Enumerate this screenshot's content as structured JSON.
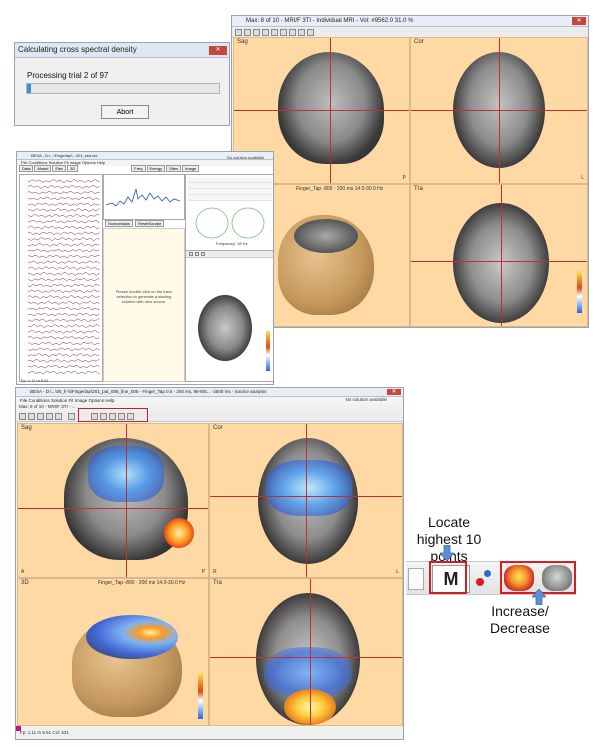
{
  "progress_dialog": {
    "title": "Calculating cross spectral density",
    "status": "Processing trial 2 of 97",
    "abort_label": "Abort",
    "progress_fraction": 0.02
  },
  "mri_window_top": {
    "title": "Max: 8 of 10 - MRI/F 3TI - Individual MRI - Vol: #9562.0 31.0 %",
    "pane_labels": {
      "sag": "Sag",
      "cor": "Cor",
      "tra": "Tra"
    },
    "caption": "Finger_Tap -800 · 200 ms 14.0-30.0 Hz",
    "corner_p": "P",
    "corner_l": "L"
  },
  "eeg_window": {
    "title": "BESA - D:\\...\\Fingertap\\...001_ssd.cnt",
    "menu": "File  Conditions  Solution  Fit  Image  Options  Help",
    "tabs": [
      "Data",
      "Model",
      "Elec",
      "3D",
      "Freq",
      "Energy",
      "Sites",
      "Image"
    ],
    "status": "No solution available",
    "sources_btn": "Sourcebasis",
    "reset_btn": "ResetSourpe",
    "hint": "Please double click on the trace selection to generate a starting solution with new source.",
    "frequency": "Frequency: 18 Hz",
    "bottom_status": "Fp: 1.11 m 8.51"
  },
  "besa_window": {
    "title": "BESA - D:\\...\\05_fr-5\\Fingertap\\201_pat_005_fine_005 - Finger_Tap 0.5 - 200 ms, 98-MS... -2500 ms - Source analysis",
    "menu": "File  Conditions  Solution  Fit  Image  Options  Help",
    "status": "No solution available",
    "subtitle": "Max: 9 of 10 - MRI/F 3TI - ...",
    "pane_labels": {
      "sag": "Sag",
      "cor": "Cor",
      "three_d": "3D",
      "tra": "Tra"
    },
    "caption": "Finger_Tap -800 · 200 ms 14.0-30.0 Hz",
    "corner_a": "A",
    "corner_p": "P",
    "corner_r": "R",
    "corner_l": "L",
    "bottom_status": "Fp: 1.11 m 8.51  Cxl: 531"
  },
  "annotations": {
    "locate_text": "Locate highest 10 points",
    "increase_text": "Increase/ Decrease",
    "locate_button_text": "M"
  },
  "colors": {
    "pane_bg": "#ffd9a4",
    "annotation_red": "#d21f26",
    "arrow_blue": "#5b8fd1"
  }
}
